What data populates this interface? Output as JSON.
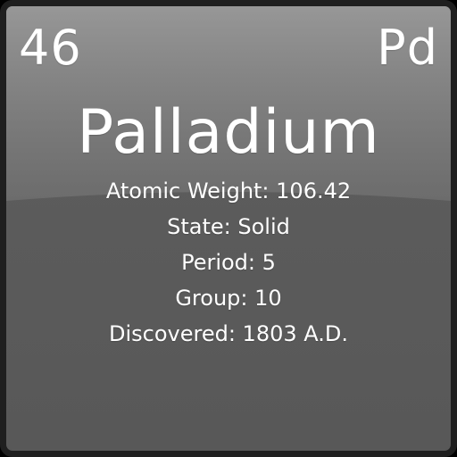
{
  "element": {
    "atomic_number": "46",
    "symbol": "Pd",
    "name": "Palladium",
    "details": {
      "atomic_weight": "Atomic Weight: 106.42",
      "state": "State: Solid",
      "period": "Period: 5",
      "group": "Group: 10",
      "discovered": "Discovered: 1803 A.D."
    }
  },
  "colors": {
    "tile_background": "#5e5e5e",
    "border": "#1f1f1f",
    "text": "#ffffff"
  }
}
